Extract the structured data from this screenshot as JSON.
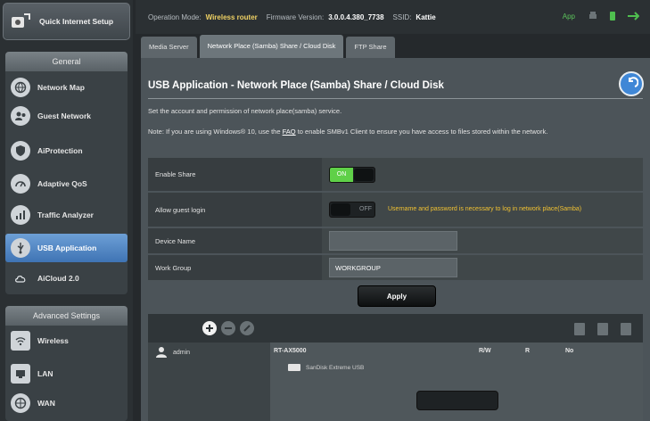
{
  "sidebar": {
    "qis_label": "Quick Internet Setup",
    "general_header": "General",
    "general_items": [
      {
        "label": "Network Map",
        "icon": "globe-icon"
      },
      {
        "label": "Guest Network",
        "icon": "guest-network-icon"
      },
      {
        "label": "AiProtection",
        "icon": "shield-icon"
      },
      {
        "label": "Adaptive QoS",
        "icon": "qos-icon"
      },
      {
        "label": "Traffic Analyzer",
        "icon": "analyzer-icon"
      },
      {
        "label": "USB Application",
        "icon": "usb-icon"
      },
      {
        "label": "AiCloud 2.0",
        "icon": "cloud-icon"
      }
    ],
    "advanced_header": "Advanced Settings",
    "advanced_items": [
      {
        "label": "Wireless",
        "icon": "wireless-icon"
      },
      {
        "label": "LAN",
        "icon": "lan-icon"
      },
      {
        "label": "WAN",
        "icon": "wan-icon"
      }
    ]
  },
  "topbar": {
    "op_mode_label": "Operation Mode:",
    "op_mode_value": "Wireless router",
    "firmware_label": "Firmware Version:",
    "firmware_value": "3.0.0.4.380_7738",
    "ssid_label": "SSID:",
    "ssid_value": "Kattie",
    "app_label": "App"
  },
  "tabs": [
    {
      "label": "Media Server"
    },
    {
      "label": "Network Place (Samba) Share / Cloud Disk"
    },
    {
      "label": "FTP Share"
    }
  ],
  "page": {
    "title": "USB Application - Network Place (Samba) Share / Cloud Disk",
    "description": "Set the account and permission of network place(samba) service.",
    "note_pre": "Note: If you are using Windows® 10, use the ",
    "note_link": "FAQ",
    "note_post": " to enable SMBv1 Client to ensure you have access to files stored within the network."
  },
  "settings": {
    "enable_share_label": "Enable Share",
    "enable_share_state": "ON",
    "guest_login_label": "Allow guest login",
    "guest_login_state": "OFF",
    "guest_login_warning": "Username and password is necessary to log in network place(Samba)",
    "device_name_label": "Device Name",
    "device_name_value": "",
    "work_group_label": "Work Group",
    "work_group_value": "WORKGROUP",
    "apply_label": "Apply"
  },
  "file_manager": {
    "user": "admin",
    "device_name": "RT-AX5000",
    "col_rw": "R/W",
    "col_r": "R",
    "col_no": "No",
    "disk_label": "SanDisk Extreme USB"
  },
  "colors": {
    "accent": "#3f74b4",
    "on_green": "#5fd048",
    "warning": "#f1c232"
  }
}
